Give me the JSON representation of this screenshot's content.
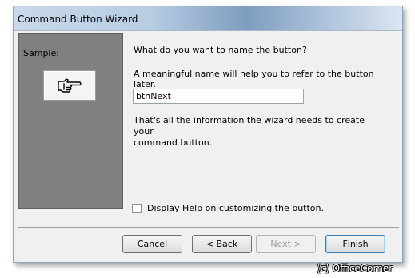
{
  "window": {
    "title": "Command Button Wizard"
  },
  "sample": {
    "label": "Sample:",
    "button_icon": "pointing-hand-icon"
  },
  "prompt": {
    "question": "What do you want to name the button?",
    "hint": "A meaningful name will help you to refer to the button later."
  },
  "name_field": {
    "value": "btnNext"
  },
  "info_text_line1": "That's all the information the wizard needs to create your",
  "info_text_line2": "command button.",
  "help_checkbox": {
    "checked": false,
    "label_accel": "D",
    "label_rest": "isplay Help on customizing the button."
  },
  "buttons": {
    "cancel": "Cancel",
    "back_prefix": "< ",
    "back_accel": "B",
    "back_rest": "ack",
    "next": "Next >",
    "finish_accel": "F",
    "finish_rest": "inish"
  },
  "watermark": "(c) OfficeCorner"
}
